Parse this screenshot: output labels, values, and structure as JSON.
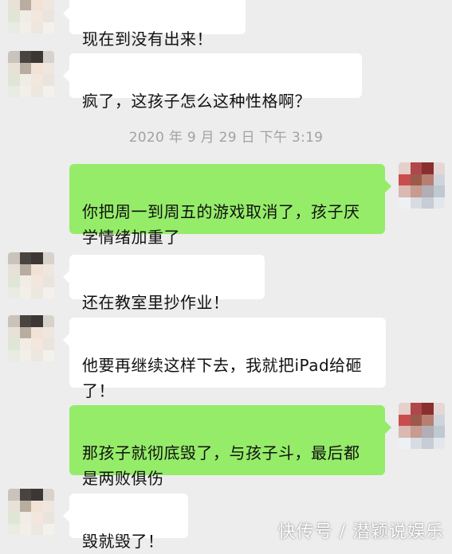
{
  "messages": [
    {
      "side": "in",
      "text": "现在到没有出来！",
      "avatar": "pixelated-avatar-contact"
    },
    {
      "side": "in",
      "text": "疯了，这孩子怎么这种性格啊？",
      "avatar": "pixelated-avatar-contact"
    },
    {
      "side": "out",
      "text": "你把周一到周五的游戏取消了，孩子厌学情绪加重了",
      "avatar": "pixelated-avatar-self"
    },
    {
      "side": "in",
      "text": "还在教室里抄作业！",
      "avatar": "pixelated-avatar-contact"
    },
    {
      "side": "in",
      "text": "他要再继续这样下去，我就把iPad给砸了！",
      "avatar": "pixelated-avatar-contact"
    },
    {
      "side": "out",
      "text": "那孩子就彻底毁了，与孩子斗，最后都是两败俱伤",
      "avatar": "pixelated-avatar-self"
    },
    {
      "side": "in",
      "text": "毁就毁了！",
      "avatar": "pixelated-avatar-contact"
    }
  ],
  "timestamp": "2020 年 9 月 29 日  下午 3:19",
  "watermark": "快传号 / 潜颖说娱乐",
  "colors": {
    "background": "#ededed",
    "incoming_bubble": "#ffffff",
    "outgoing_bubble": "#95ec69",
    "timestamp_text": "#a2a2a2"
  }
}
